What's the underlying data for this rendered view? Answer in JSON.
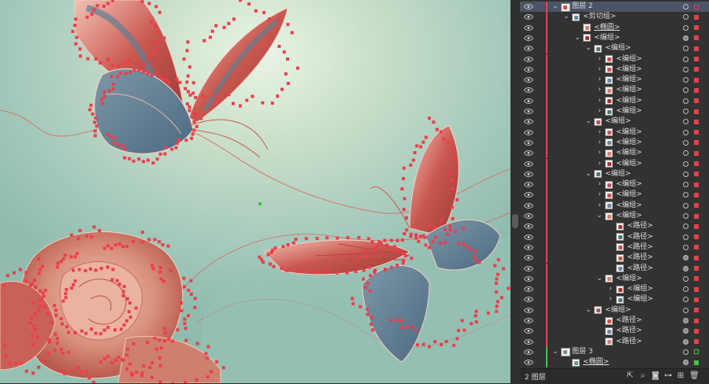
{
  "colors": {
    "selection_red": "#e8414b",
    "selection_green": "#3ec93c",
    "panel_bg": "#323232",
    "selected_row": "#4b5466"
  },
  "layers_panel": {
    "rows": [
      {
        "label": "图层 2",
        "indent": 0,
        "arrow": "down",
        "selected": true,
        "color": "red",
        "top_level": true,
        "target": "empty"
      },
      {
        "label": "<剪切组>",
        "indent": 1,
        "arrow": "down",
        "color": "red",
        "target": "empty"
      },
      {
        "label": "<椭圆>",
        "indent": 2,
        "arrow": "none",
        "color": "red",
        "underline": true,
        "target": "empty"
      },
      {
        "label": "<编组>",
        "indent": 2,
        "arrow": "down",
        "color": "red",
        "target": "filled"
      },
      {
        "label": "<编组>",
        "indent": 3,
        "arrow": "down",
        "color": "red",
        "target": "empty"
      },
      {
        "label": "<编组>",
        "indent": 4,
        "arrow": "right",
        "color": "red",
        "target": "empty"
      },
      {
        "label": "<编组>",
        "indent": 4,
        "arrow": "right",
        "color": "red",
        "target": "empty"
      },
      {
        "label": "<编组>",
        "indent": 4,
        "arrow": "right",
        "color": "red",
        "target": "empty"
      },
      {
        "label": "<编组>",
        "indent": 4,
        "arrow": "right",
        "color": "red",
        "target": "empty"
      },
      {
        "label": "<编组>",
        "indent": 4,
        "arrow": "right",
        "color": "red",
        "target": "empty"
      },
      {
        "label": "<编组>",
        "indent": 4,
        "arrow": "right",
        "color": "red",
        "target": "empty"
      },
      {
        "label": "<编组>",
        "indent": 3,
        "arrow": "down",
        "color": "red",
        "target": "empty"
      },
      {
        "label": "<编组>",
        "indent": 4,
        "arrow": "right",
        "color": "red",
        "target": "empty"
      },
      {
        "label": "<编组>",
        "indent": 4,
        "arrow": "right",
        "color": "red",
        "target": "empty"
      },
      {
        "label": "<编组>",
        "indent": 4,
        "arrow": "right",
        "color": "red",
        "target": "empty"
      },
      {
        "label": "<编组>",
        "indent": 4,
        "arrow": "right",
        "color": "red",
        "target": "empty"
      },
      {
        "label": "<编组>",
        "indent": 3,
        "arrow": "down",
        "color": "red",
        "target": "empty"
      },
      {
        "label": "<编组>",
        "indent": 4,
        "arrow": "right",
        "color": "red",
        "target": "empty"
      },
      {
        "label": "<编组>",
        "indent": 4,
        "arrow": "right",
        "color": "red",
        "target": "empty"
      },
      {
        "label": "<编组>",
        "indent": 4,
        "arrow": "right",
        "color": "red",
        "target": "empty"
      },
      {
        "label": "<编组>",
        "indent": 4,
        "arrow": "down",
        "color": "red",
        "target": "empty"
      },
      {
        "label": "<路径>",
        "indent": 5,
        "arrow": "none",
        "color": "red",
        "target": "empty"
      },
      {
        "label": "<路径>",
        "indent": 5,
        "arrow": "none",
        "color": "red",
        "target": "empty"
      },
      {
        "label": "<路径>",
        "indent": 5,
        "arrow": "none",
        "color": "red",
        "target": "empty"
      },
      {
        "label": "<路径>",
        "indent": 5,
        "arrow": "none",
        "color": "red",
        "target": "filled"
      },
      {
        "label": "<路径>",
        "indent": 5,
        "arrow": "none",
        "color": "red",
        "target": "filled"
      },
      {
        "label": "<编组>",
        "indent": 4,
        "arrow": "down",
        "color": "red",
        "target": "empty"
      },
      {
        "label": "<编组>",
        "indent": 5,
        "arrow": "right",
        "color": "red",
        "target": "empty"
      },
      {
        "label": "<编组>",
        "indent": 5,
        "arrow": "right",
        "color": "red",
        "target": "empty"
      },
      {
        "label": "<编组>",
        "indent": 3,
        "arrow": "down",
        "color": "red",
        "target": "empty"
      },
      {
        "label": "<路径>",
        "indent": 4,
        "arrow": "none",
        "color": "red",
        "target": "filled"
      },
      {
        "label": "<路径>",
        "indent": 4,
        "arrow": "none",
        "color": "red",
        "target": "filled"
      },
      {
        "label": "<路径>",
        "indent": 4,
        "arrow": "none",
        "color": "red",
        "target": "filled"
      },
      {
        "label": "图层 3",
        "indent": 0,
        "arrow": "down",
        "color": "green",
        "top_level": true,
        "target": "empty"
      },
      {
        "label": "<椭圆>",
        "indent": 1,
        "arrow": "none",
        "color": "green",
        "underline": true,
        "target": "filled"
      }
    ],
    "footer": {
      "count": "2 图层",
      "icons": [
        "export-icon",
        "search-icon",
        "clipping-mask-icon",
        "new-sublayer-icon",
        "new-layer-icon",
        "delete-icon"
      ]
    }
  }
}
